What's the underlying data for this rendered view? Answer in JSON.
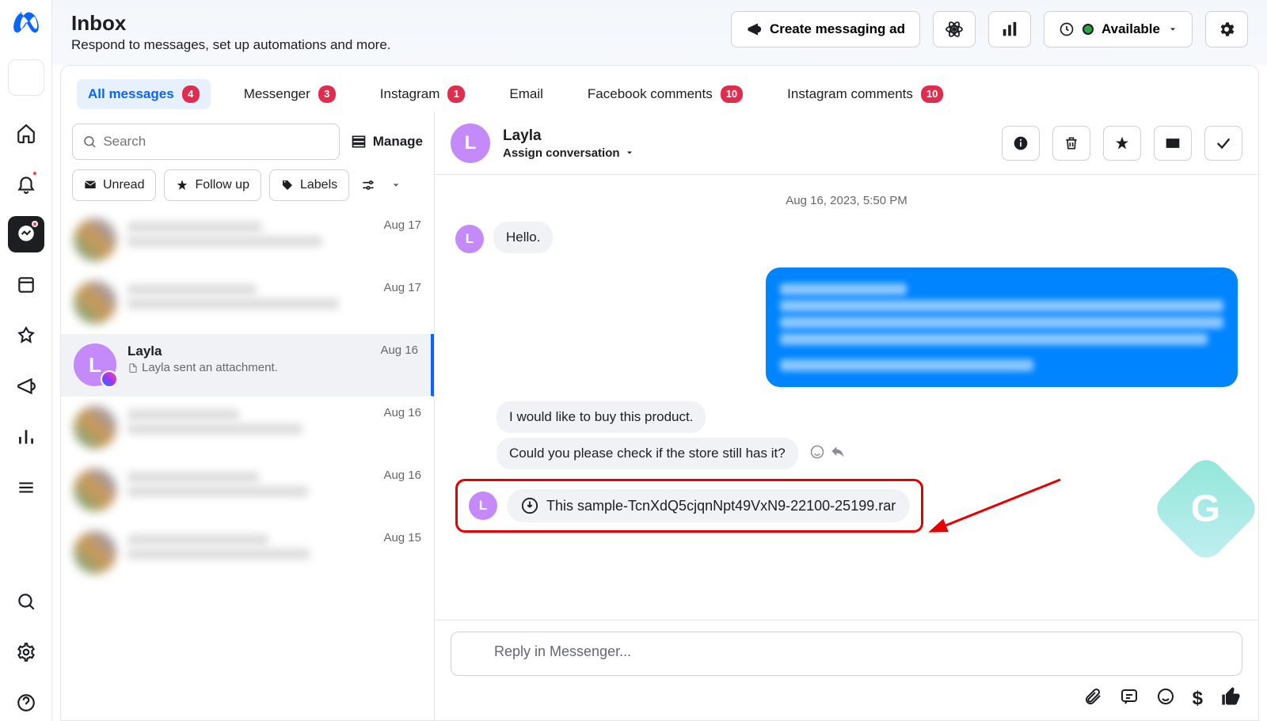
{
  "header": {
    "title": "Inbox",
    "subtitle": "Respond to messages, set up automations and more.",
    "create_ad": "Create messaging ad",
    "availability": "Available"
  },
  "tabs": [
    {
      "label": "All messages",
      "badge": "4",
      "active": true
    },
    {
      "label": "Messenger",
      "badge": "3"
    },
    {
      "label": "Instagram",
      "badge": "1"
    },
    {
      "label": "Email",
      "badge": ""
    },
    {
      "label": "Facebook comments",
      "badge": "10"
    },
    {
      "label": "Instagram comments",
      "badge": "10"
    }
  ],
  "search": {
    "placeholder": "Search"
  },
  "manage_label": "Manage",
  "filters": {
    "unread": "Unread",
    "followup": "Follow up",
    "labels": "Labels"
  },
  "conversations": [
    {
      "name": "",
      "preview": "",
      "date": "Aug 17",
      "blurred": true
    },
    {
      "name": "",
      "preview": "",
      "date": "Aug 17",
      "blurred": true
    },
    {
      "name": "Layla",
      "preview": "Layla sent an attachment.",
      "date": "Aug 16",
      "selected": true,
      "initial": "L"
    },
    {
      "name": "",
      "preview": "",
      "date": "Aug 16",
      "blurred": true
    },
    {
      "name": "",
      "preview": "",
      "date": "Aug 16",
      "blurred": true
    },
    {
      "name": "",
      "preview": "",
      "date": "Aug 15",
      "blurred": true
    }
  ],
  "chat": {
    "name": "Layla",
    "initial": "L",
    "assign": "Assign conversation",
    "timestamp": "Aug 16, 2023, 5:50 PM",
    "msg_hello": "Hello.",
    "msg_buy": "I would like to buy this product.",
    "msg_check": "Could you please check if the store still has it?",
    "attachment": "This sample-TcnXdQ5cjqnNpt49VxN9-22100-25199.rar",
    "reply_placeholder": "Reply in Messenger..."
  }
}
